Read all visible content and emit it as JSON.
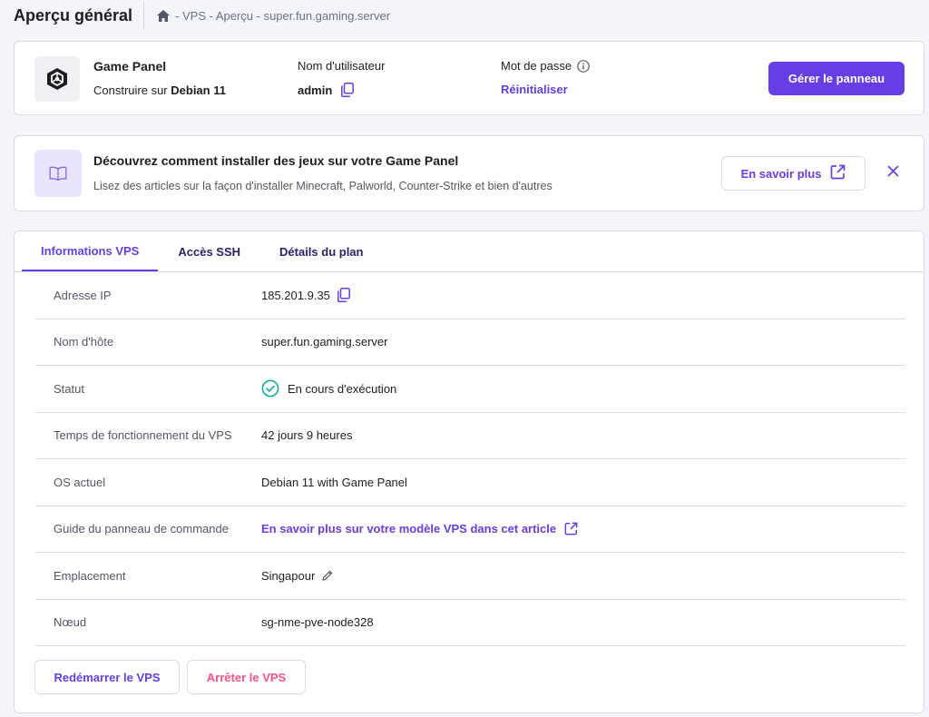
{
  "header": {
    "title": "Aperçu général",
    "breadcrumb": "- VPS - Aperçu - super.fun.gaming.server"
  },
  "app_card": {
    "name": "Game Panel",
    "built_prefix": "Construire sur",
    "built_os": "Debian 11",
    "username_label": "Nom d'utilisateur",
    "username_value": "admin",
    "password_label": "Mot de passe",
    "password_action": "Réinitialiser",
    "manage_button": "Gérer le panneau"
  },
  "promo": {
    "title": "Découvrez comment installer des jeux sur votre Game Panel",
    "subtitle": "Lisez des articles sur la façon d'installer Minecraft, Palworld, Counter-Strike et bien d'autres",
    "button": "En savoir plus"
  },
  "tabs": [
    {
      "label": "Informations VPS",
      "active": true
    },
    {
      "label": "Accès SSH",
      "active": false
    },
    {
      "label": "Détails du plan",
      "active": false
    }
  ],
  "details": [
    {
      "label": "Adresse IP",
      "value": "185.201.9.35"
    },
    {
      "label": "Nom d'hôte",
      "value": "super.fun.gaming.server"
    },
    {
      "label": "Statut",
      "value": "En cours d'exécution"
    },
    {
      "label": "Temps de fonctionnement du VPS",
      "value": "42 jours 9 heures"
    },
    {
      "label": "OS actuel",
      "value": "Debian 11 with Game Panel"
    },
    {
      "label": "Guide du panneau de commande",
      "value": "En savoir plus sur votre modèle VPS dans cet article"
    },
    {
      "label": "Emplacement",
      "value": "Singapour"
    },
    {
      "label": "Nœud",
      "value": "sg-nme-pve-node328"
    }
  ],
  "actions": {
    "restart": "Redémarrer le VPS",
    "stop": "Arrêter le VPS"
  },
  "icons": {
    "home": "home-icon",
    "copy": "copy-icon",
    "info": "info-icon",
    "book": "book-icon",
    "external": "external-link-icon",
    "close": "close-icon",
    "check": "check-circle-icon",
    "edit": "pencil-icon"
  },
  "colors": {
    "primary": "#673de6",
    "danger": "#fc5185",
    "success": "#00b090",
    "text": "#1d1e20",
    "muted": "#545668"
  }
}
